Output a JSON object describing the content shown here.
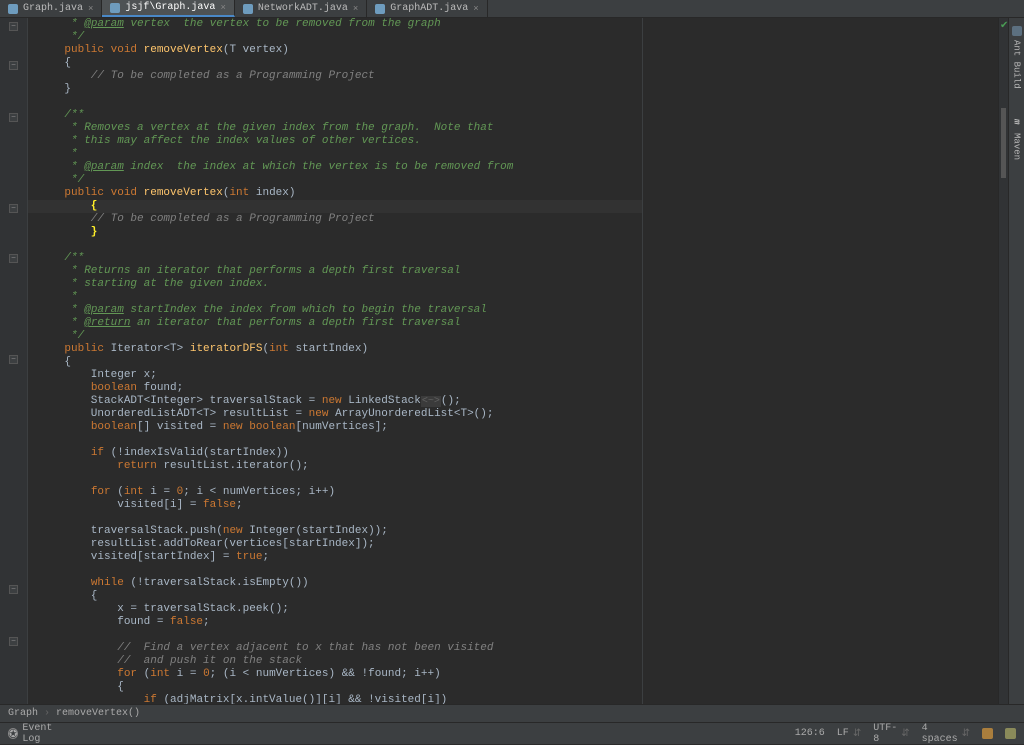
{
  "tabs": [
    {
      "label": "Graph.java"
    },
    {
      "label": "jsjf\\Graph.java"
    },
    {
      "label": "NetworkADT.java"
    },
    {
      "label": "GraphADT.java"
    }
  ],
  "right_tools": {
    "ant": "Ant Build",
    "maven": "Maven"
  },
  "breadcrumb": {
    "class": "Graph",
    "method": "removeVertex()"
  },
  "status": {
    "event_log": "Event Log",
    "position": "126:6",
    "line_sep": "LF",
    "encoding": "UTF-8",
    "indent": "4 spaces"
  },
  "code": {
    "l1a": "     * ",
    "l1b": "@param",
    "l1c": " vertex  the vertex to be removed from the graph",
    "l2": "     */",
    "l3a": "    ",
    "l3b": "public void ",
    "l3c": "removeVertex",
    "l3d": "(T vertex)",
    "l4": "    {",
    "l5": "        // To be completed as a Programming Project",
    "l6": "    }",
    "l7": "",
    "l8": "    /**",
    "l9": "     * Removes a vertex at the given index from the graph.  Note that",
    "l10": "     * this may affect the index values of other vertices.",
    "l11": "     *",
    "l12a": "     * ",
    "l12b": "@param",
    "l12c": " index  the index at which the vertex is to be removed from",
    "l13": "     */",
    "l14a": "    ",
    "l14b": "public void ",
    "l14c": "removeVertex",
    "l14d": "(",
    "l14e": "int",
    "l14f": " index)",
    "l15": "    {",
    "l16": "        // To be completed as a Programming Project",
    "l17": "    }",
    "l18": "",
    "l19": "    /**",
    "l20": "     * Returns an iterator that performs a depth first traversal",
    "l21": "     * starting at the given index.",
    "l22": "     *",
    "l23a": "     * ",
    "l23b": "@param",
    "l23c": " startIndex the index from which to begin the traversal",
    "l24a": "     * ",
    "l24b": "@return",
    "l24c": " an iterator that performs a depth first traversal",
    "l25": "     */",
    "l26a": "    ",
    "l26b": "public ",
    "l26c": "Iterator<T> ",
    "l26d": "iteratorDFS",
    "l26e": "(",
    "l26f": "int",
    "l26g": " startIndex)",
    "l27": "    {",
    "l28": "        Integer x;",
    "l29a": "        ",
    "l29b": "boolean",
    "l29c": " found;",
    "l30a": "        StackADT<Integer> traversalStack = ",
    "l30b": "new ",
    "l30c": "LinkedStack",
    "l30d": "<~>",
    "l30e": "();",
    "l31a": "        UnorderedListADT<T> resultList = ",
    "l31b": "new ",
    "l31c": "ArrayUnorderedList<T>();",
    "l32a": "        ",
    "l32b": "boolean",
    "l32c": "[] visited = ",
    "l32d": "new boolean",
    "l32e": "[numVertices];",
    "l33": "",
    "l34a": "        ",
    "l34b": "if ",
    "l34c": "(!indexIsValid(startIndex))",
    "l35a": "            ",
    "l35b": "return ",
    "l35c": "resultList.iterator();",
    "l36": "",
    "l37a": "        ",
    "l37b": "for ",
    "l37c": "(",
    "l37d": "int",
    "l37e": " i = ",
    "l37f": "0",
    "l37g": "; i < numVertices; i++)",
    "l38a": "            visited[i] = ",
    "l38b": "false",
    "l38c": ";",
    "l39": "",
    "l40a": "        traversalStack.push(",
    "l40b": "new ",
    "l40c": "Integer(startIndex));",
    "l41": "        resultList.addToRear(vertices[startIndex]);",
    "l42a": "        visited[startIndex] = ",
    "l42b": "true",
    "l42c": ";",
    "l43": "",
    "l44a": "        ",
    "l44b": "while ",
    "l44c": "(!traversalStack.isEmpty())",
    "l45": "        {",
    "l46": "            x = traversalStack.peek();",
    "l47a": "            found = ",
    "l47b": "false",
    "l47c": ";",
    "l48": "",
    "l49": "            //  Find a vertex adjacent to x that has not been visited",
    "l50": "            //  and push it on the stack",
    "l51a": "            ",
    "l51b": "for ",
    "l51c": "(",
    "l51d": "int",
    "l51e": " i = ",
    "l51f": "0",
    "l51g": "; (i < numVertices) && !found; i++)",
    "l52": "            {",
    "l53a": "                ",
    "l53b": "if ",
    "l53c": "(adjMatrix[x.intValue()][i] && !visited[i])"
  }
}
